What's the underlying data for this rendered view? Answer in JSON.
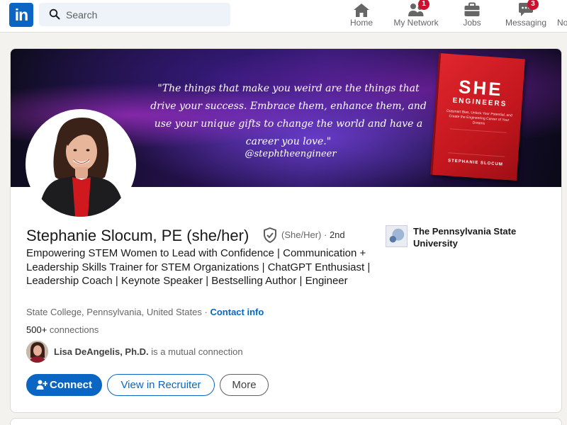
{
  "topbar": {
    "logo_text": "in",
    "search": {
      "placeholder": "Search"
    },
    "nav": [
      {
        "label": "Home",
        "icon": "home-icon",
        "badge": null
      },
      {
        "label": "My Network",
        "icon": "people-icon",
        "badge": "1"
      },
      {
        "label": "Jobs",
        "icon": "briefcase-icon",
        "badge": null
      },
      {
        "label": "Messaging",
        "icon": "chat-icon",
        "badge": "3"
      },
      {
        "label": "No"
      }
    ]
  },
  "banner": {
    "quote": "\"The things that make you weird are the things that drive your success. Embrace them, enhance them, and use your unique gifts to change the world and have a career you love.\"",
    "handle": "@stephtheengineer",
    "book": {
      "title": "SHE",
      "subtitle": "ENGINEERS",
      "blurb": "Outsmart Bias, Unlock Your Potential, and Create the Engineering Career of Your Dreams",
      "author": "STEPHANIE SLOCUM"
    }
  },
  "profile": {
    "name": "Stephanie Slocum, PE (she/her)",
    "pronouns": "(She/Her)",
    "separator": "·",
    "degree": "2nd",
    "headline": "Empowering STEM Women to Lead with Confidence | Communication + Leadership Skills Trainer for STEM Organizations | ChatGPT Enthusiast | Leadership Coach | Keynote Speaker | Bestselling Author | Engineer",
    "location": "State College, Pennsylvania, United States",
    "location_separator": "·",
    "contact_info": "Contact info",
    "connections_count": "500+",
    "connections_label": "connections",
    "mutual": {
      "name": "Lisa DeAngelis, Ph.D.",
      "text": "is a mutual connection"
    },
    "school": "The Pennsylvania State University"
  },
  "actions": {
    "connect": "Connect",
    "recruiter": "View in Recruiter",
    "more": "More"
  },
  "colors": {
    "brand": "#0a66c2",
    "badge": "#cb112d",
    "background": "#f4f2ee",
    "book": "#e1262e"
  }
}
